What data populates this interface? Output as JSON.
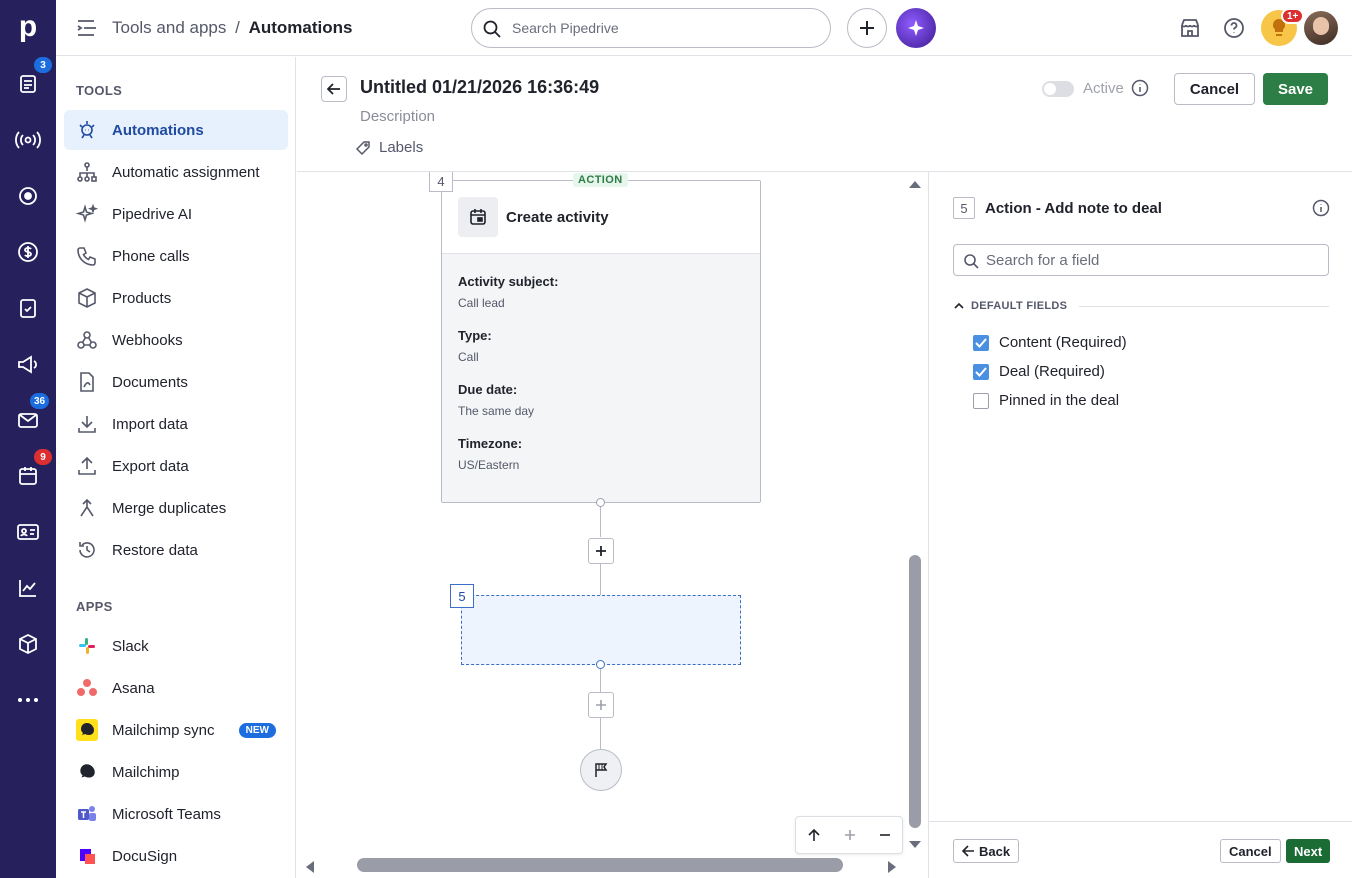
{
  "rail": {
    "badges": {
      "leads": "3",
      "mail": "36",
      "calendar": "9"
    }
  },
  "topbar": {
    "breadcrumb_parent": "Tools and apps",
    "breadcrumb_sep": "/",
    "breadcrumb_current": "Automations",
    "search_placeholder": "Search Pipedrive",
    "tips_badge": "1+"
  },
  "sidebar": {
    "tools_title": "TOOLS",
    "apps_title": "APPS",
    "tools": [
      {
        "label": "Automations",
        "icon": "automation-robot-icon"
      },
      {
        "label": "Automatic assignment",
        "icon": "assignment-icon"
      },
      {
        "label": "Pipedrive AI",
        "icon": "sparkle-icon"
      },
      {
        "label": "Phone calls",
        "icon": "phone-icon"
      },
      {
        "label": "Products",
        "icon": "box-icon"
      },
      {
        "label": "Webhooks",
        "icon": "webhook-icon"
      },
      {
        "label": "Documents",
        "icon": "document-icon"
      },
      {
        "label": "Import data",
        "icon": "import-icon"
      },
      {
        "label": "Export data",
        "icon": "export-icon"
      },
      {
        "label": "Merge duplicates",
        "icon": "merge-icon"
      },
      {
        "label": "Restore data",
        "icon": "restore-icon"
      }
    ],
    "apps": [
      {
        "label": "Slack",
        "icon": "slack-icon"
      },
      {
        "label": "Asana",
        "icon": "asana-icon"
      },
      {
        "label": "Mailchimp sync",
        "icon": "mailchimp-icon",
        "badge": "NEW"
      },
      {
        "label": "Mailchimp",
        "icon": "mailchimp-icon"
      },
      {
        "label": "Microsoft Teams",
        "icon": "teams-icon"
      },
      {
        "label": "DocuSign",
        "icon": "docusign-icon"
      }
    ]
  },
  "header": {
    "title": "Untitled 01/21/2026 16:36:49",
    "description": "Description",
    "labels": "Labels",
    "active_label": "Active",
    "cancel": "Cancel",
    "save": "Save"
  },
  "canvas": {
    "node4": {
      "number": "4",
      "tag": "ACTION",
      "title": "Create activity",
      "fields": [
        {
          "key": "Activity subject:",
          "value": "Call lead"
        },
        {
          "key": "Type:",
          "value": "Call"
        },
        {
          "key": "Due date:",
          "value": "The same day"
        },
        {
          "key": "Timezone:",
          "value": "US/Eastern"
        }
      ]
    },
    "node5_number": "5"
  },
  "panel": {
    "step_number": "5",
    "title": "Action - Add note to deal",
    "search_placeholder": "Search for a field",
    "section_title": "DEFAULT FIELDS",
    "fields": [
      {
        "label": "Content (Required)",
        "checked": true
      },
      {
        "label": "Deal (Required)",
        "checked": true
      },
      {
        "label": "Pinned in the deal",
        "checked": false
      }
    ],
    "back": "Back",
    "cancel": "Cancel",
    "next": "Next"
  },
  "colors": {
    "rail": "#26215d",
    "save_green": "#2d7d46",
    "next_green": "#1b6b35",
    "active_bg": "#e7f0fd",
    "accent_blue": "#1c6de0"
  }
}
